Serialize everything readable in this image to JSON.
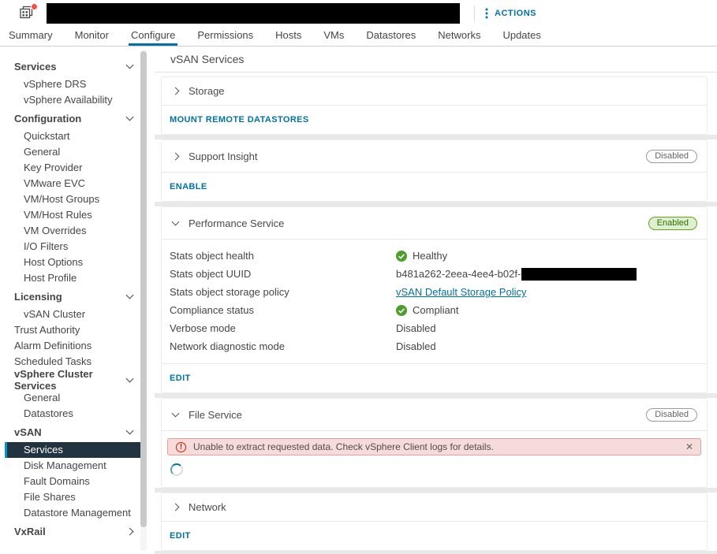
{
  "header": {
    "actions_label": "ACTIONS"
  },
  "tabs": {
    "active": "Configure",
    "items": [
      "Summary",
      "Monitor",
      "Configure",
      "Permissions",
      "Hosts",
      "VMs",
      "Datastores",
      "Networks",
      "Updates"
    ]
  },
  "sidebar": {
    "items": [
      {
        "label": "Services",
        "type": "group",
        "expanded": true
      },
      {
        "label": "vSphere DRS",
        "type": "item"
      },
      {
        "label": "vSphere Availability",
        "type": "item"
      },
      {
        "label": "Configuration",
        "type": "group",
        "expanded": true
      },
      {
        "label": "Quickstart",
        "type": "item"
      },
      {
        "label": "General",
        "type": "item"
      },
      {
        "label": "Key Provider",
        "type": "item"
      },
      {
        "label": "VMware EVC",
        "type": "item"
      },
      {
        "label": "VM/Host Groups",
        "type": "item"
      },
      {
        "label": "VM/Host Rules",
        "type": "item"
      },
      {
        "label": "VM Overrides",
        "type": "item"
      },
      {
        "label": "I/O Filters",
        "type": "item"
      },
      {
        "label": "Host Options",
        "type": "item"
      },
      {
        "label": "Host Profile",
        "type": "item"
      },
      {
        "label": "Licensing",
        "type": "group",
        "expanded": true
      },
      {
        "label": "vSAN Cluster",
        "type": "item"
      },
      {
        "label": "Trust Authority",
        "type": "root-item"
      },
      {
        "label": "Alarm Definitions",
        "type": "root-item"
      },
      {
        "label": "Scheduled Tasks",
        "type": "root-item"
      },
      {
        "label": "vSphere Cluster Services",
        "type": "group",
        "expanded": true
      },
      {
        "label": "General",
        "type": "item"
      },
      {
        "label": "Datastores",
        "type": "item"
      },
      {
        "label": "vSAN",
        "type": "group",
        "expanded": true
      },
      {
        "label": "Services",
        "type": "item",
        "selected": true
      },
      {
        "label": "Disk Management",
        "type": "item"
      },
      {
        "label": "Fault Domains",
        "type": "item"
      },
      {
        "label": "File Shares",
        "type": "item"
      },
      {
        "label": "Datastore Management",
        "type": "item"
      },
      {
        "label": "VxRail",
        "type": "group",
        "expanded": false
      }
    ]
  },
  "main": {
    "title": "vSAN Services",
    "storage": {
      "title": "Storage",
      "collapsed": true,
      "action_label": "MOUNT REMOTE DATASTORES"
    },
    "support_insight": {
      "title": "Support Insight",
      "collapsed": true,
      "status": "Disabled",
      "action_label": "ENABLE"
    },
    "performance": {
      "title": "Performance Service",
      "collapsed": false,
      "status": "Enabled",
      "action_label": "EDIT",
      "rows": [
        {
          "label": "Stats object health",
          "value": "Healthy",
          "status_icon": "success"
        },
        {
          "label": "Stats object UUID",
          "value": "b481a262-2eea-4ee4-b02f-",
          "redacted_suffix": true
        },
        {
          "label": "Stats object storage policy",
          "value": "vSAN Default Storage Policy",
          "link": true
        },
        {
          "label": "Compliance status",
          "value": "Compliant",
          "status_icon": "success"
        },
        {
          "label": "Verbose mode",
          "value": "Disabled"
        },
        {
          "label": "Network diagnostic mode",
          "value": "Disabled"
        }
      ]
    },
    "file_service": {
      "title": "File Service",
      "collapsed": false,
      "status": "Disabled",
      "error_message": "Unable to extract requested data. Check vSphere Client logs for details.",
      "loading": true
    },
    "network": {
      "title": "Network",
      "collapsed": true,
      "action_label": "EDIT"
    }
  },
  "colors": {
    "accent": "#0072a3",
    "tab_underline": "#0072a3",
    "nav_selected_bg": "#22343f",
    "nav_selected_bar": "#0095d3",
    "success_green": "#4d9e2f",
    "badge_enabled_bg": "#dff0d0",
    "badge_enabled_border": "#62a420",
    "badge_enabled_text": "#306b00",
    "badge_disabled_border": "#9a9a9a",
    "badge_disabled_text": "#666666",
    "alert_bg": "#f5dbd9",
    "alert_border": "#dfa0a0",
    "alert_icon_red": "#c92100",
    "notification_badge": "#f55047"
  }
}
